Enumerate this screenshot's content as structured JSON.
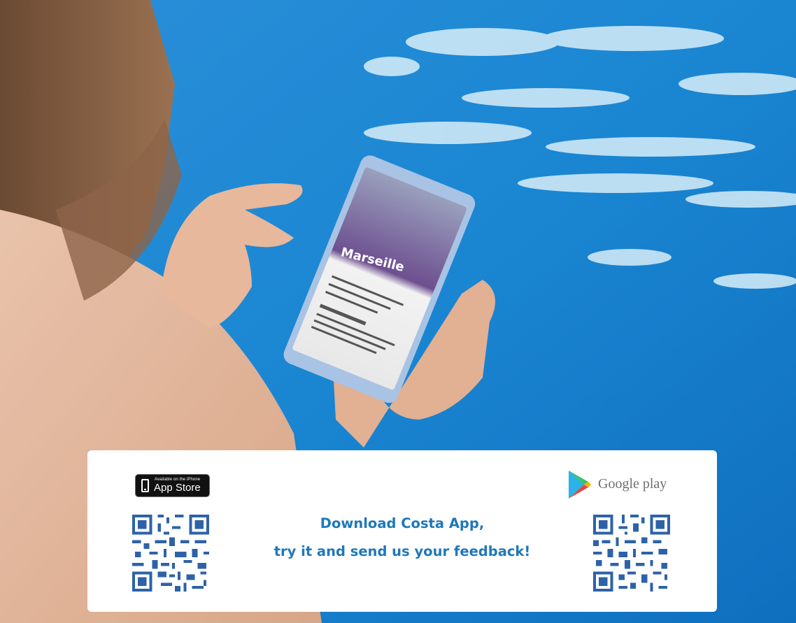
{
  "badges": {
    "app_store_small": "Available on the iPhone",
    "app_store_big": "App Store",
    "google_play": "Google play"
  },
  "cta": {
    "line1": "Download Costa App,",
    "line2": "try it and send us your feedback!"
  },
  "colors": {
    "cta_text": "#1f78b9",
    "pool": "#1f8fd6",
    "panel": "#ffffff"
  },
  "icons": [
    "apple-phone-icon",
    "google-play-icon",
    "qr-code-icon"
  ]
}
